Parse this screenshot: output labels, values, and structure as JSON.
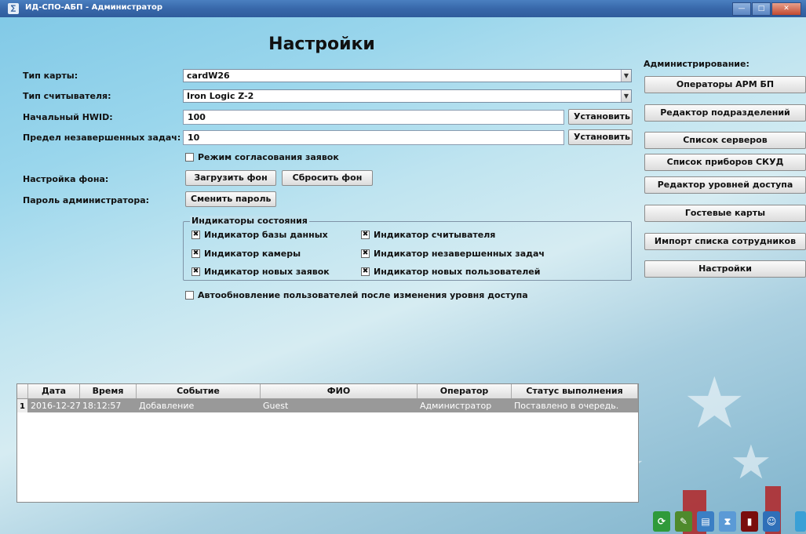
{
  "window": {
    "title": "ИД-СПО-АБП - Администратор",
    "icon": "app-icon"
  },
  "page_title": "Настройки",
  "settings": {
    "card_type_label": "Тип карты:",
    "card_type_value": "cardW26",
    "reader_type_label": "Тип считывателя:",
    "reader_type_value": "Iron Logic Z-2",
    "hwid_label": "Начальный HWID:",
    "hwid_value": "100",
    "tasks_label": "Предел незавершенных задач:",
    "tasks_value": "10",
    "set_label": "Установить",
    "approval_mode_label": "Режим согласования заявок",
    "background_label": "Настройка фона:",
    "load_bg_label": "Загрузить фон",
    "reset_bg_label": "Сбросить фон",
    "admin_password_label": "Пароль администратора:",
    "change_password_label": "Сменить пароль",
    "auto_update_label": "Автообновление пользователей после изменения уровня доступа"
  },
  "indicators": {
    "legend": "Индикаторы состояния",
    "items": [
      {
        "label": "Индикатор базы данных",
        "checked": true
      },
      {
        "label": "Индикатор считывателя",
        "checked": true
      },
      {
        "label": "Индикатор камеры",
        "checked": true
      },
      {
        "label": "Индикатор незавершенных задач",
        "checked": true
      },
      {
        "label": "Индикатор новых заявок",
        "checked": true
      },
      {
        "label": "Индикатор новых пользователей",
        "checked": true
      }
    ]
  },
  "sidebar": {
    "title": "Администрирование:",
    "buttons": [
      "Операторы АРМ БП",
      "Редактор подразделений",
      "Список серверов",
      "Список приборов СКУД",
      "Редактор уровней доступа",
      "Гостевые карты",
      "Импорт списка сотрудников",
      "Настройки"
    ]
  },
  "log": {
    "columns": [
      "Дата",
      "Время",
      "Событие",
      "ФИО",
      "Оператор",
      "Статус выполнения"
    ],
    "rows": [
      {
        "num": "1",
        "date": "2016-12-27",
        "time": "18:12:57",
        "event": "Добавление",
        "name": "Guest",
        "operator": "Администратор",
        "status": "Поставлено в очередь."
      }
    ]
  },
  "checkbox_mark": "✖",
  "colors": {
    "titlebar": "#3868aa",
    "selected_row": "#999999",
    "background": "#bfe4f0"
  },
  "tray_icons": [
    "refresh-icon",
    "edit-icon",
    "card-icon",
    "hourglass-icon",
    "door-icon",
    "user-icon",
    "database-icon"
  ]
}
